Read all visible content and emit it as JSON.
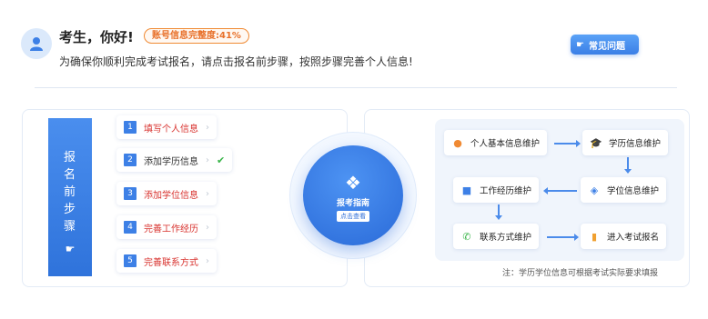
{
  "header": {
    "greeting": "考生，你好!",
    "completeness_badge": "账号信息完整度:41%",
    "subtitle": "为确保你顺利完成考试报名，请点击报名前步骤，按照步骤完善个人信息!",
    "faq_label": "常见问题"
  },
  "banner": {
    "chars": [
      "报",
      "名",
      "前",
      "步",
      "骤"
    ]
  },
  "steps": [
    {
      "num": "1",
      "label": "填写个人信息",
      "status": "incomplete"
    },
    {
      "num": "2",
      "label": "添加学历信息",
      "status": "complete"
    },
    {
      "num": "3",
      "label": "添加学位信息",
      "status": "incomplete"
    },
    {
      "num": "4",
      "label": "完善工作经历",
      "status": "incomplete"
    },
    {
      "num": "5",
      "label": "完善联系方式",
      "status": "incomplete"
    }
  ],
  "guide": {
    "title": "报考指南",
    "button": "点击查看"
  },
  "flow": {
    "nodes": {
      "personal": "个人基本信息维护",
      "education": "学历信息维护",
      "degree": "学位信息维护",
      "work": "工作经历维护",
      "contact": "联系方式维护",
      "enter": "进入考试报名"
    },
    "note": "注：学历学位信息可根据考试实际要求填报"
  },
  "colors": {
    "primary": "#3d80e6",
    "warning": "#e8702a",
    "incomplete_text": "#d8322e",
    "complete_check": "#3ab54a"
  }
}
